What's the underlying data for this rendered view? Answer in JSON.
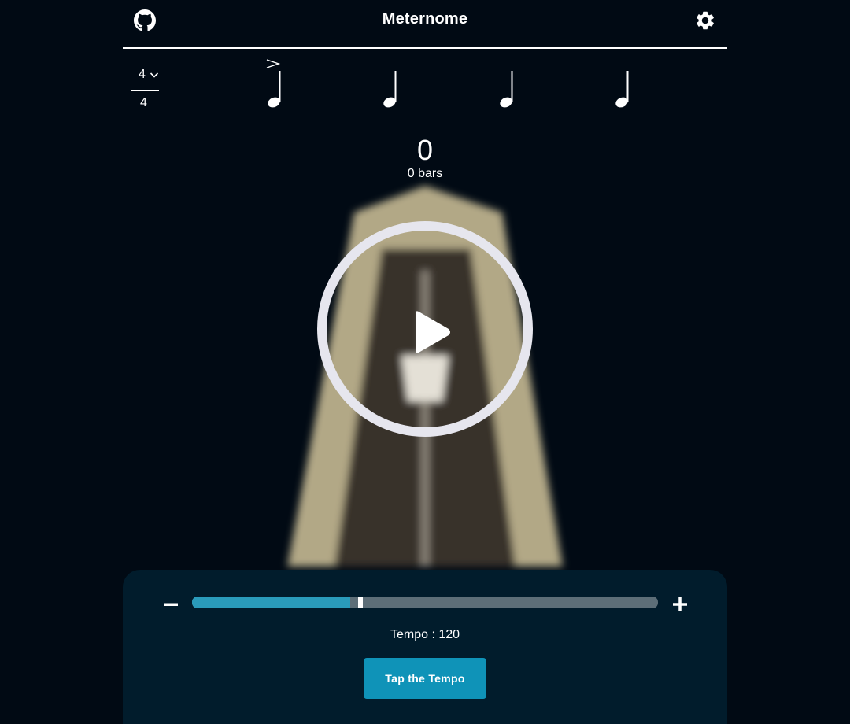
{
  "header": {
    "title": "Meternome",
    "github_icon": "github-icon",
    "settings_icon": "gear-icon"
  },
  "time_signature": {
    "numerator": "4",
    "denominator": "4"
  },
  "beats": [
    {
      "note": "quarter-note",
      "accent": true
    },
    {
      "note": "quarter-note",
      "accent": false
    },
    {
      "note": "quarter-note",
      "accent": false
    },
    {
      "note": "quarter-note",
      "accent": false
    }
  ],
  "counter": {
    "count": "0",
    "bars_label": "0 bars"
  },
  "play_icon": "play-icon",
  "tempo": {
    "label": "Tempo : 120",
    "value": 120,
    "slider_fraction": 0.34,
    "tap_button": "Tap the Tempo",
    "decrease_icon": "minus-icon",
    "increase_icon": "plus-icon"
  },
  "colors": {
    "background": "#010a14",
    "panel": "#011c2c",
    "accent": "#0f93b8",
    "slider_fill": "#2a9bbb",
    "metronome_body": "#b2a886",
    "metronome_face": "#38302c"
  }
}
